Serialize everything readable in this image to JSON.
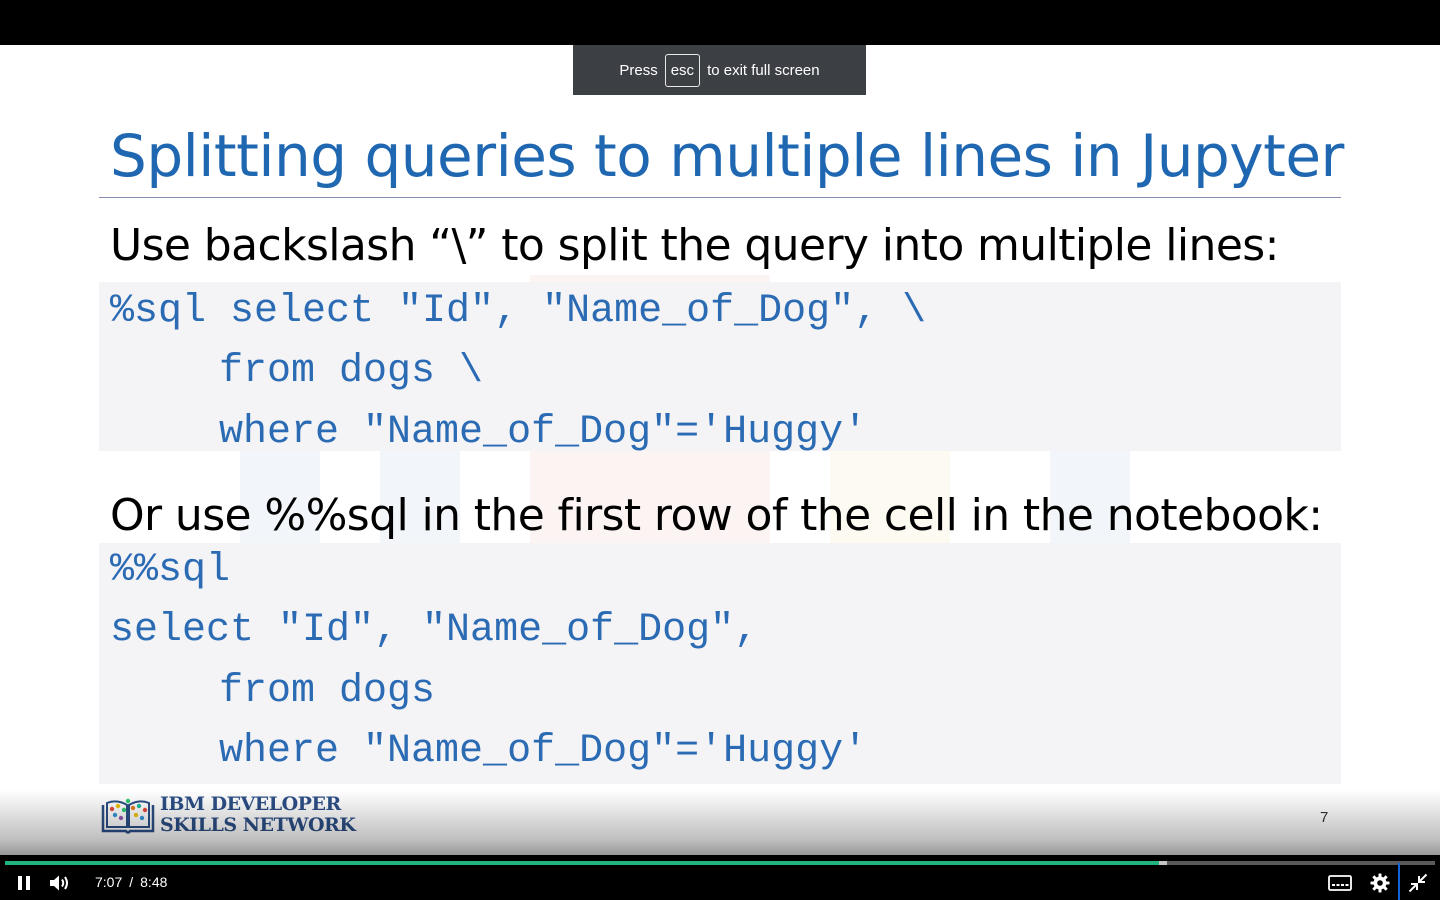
{
  "fullscreen_notice": {
    "prefix": "Press",
    "key": "esc",
    "suffix": "to exit full screen"
  },
  "slide": {
    "title": "Splitting queries to multiple lines in Jupyter",
    "instruction_1": "Use backslash “\\”  to split the query into multiple lines:",
    "code_1": [
      "%sql select \"Id\", \"Name_of_Dog\", \\",
      "    from dogs \\",
      "    where \"Name_of_Dog\"='Huggy'"
    ],
    "instruction_2": "Or use %%sql in the first row of the cell in the notebook:",
    "code_2": [
      "%%sql",
      "select \"Id\", \"Name_of_Dog\",",
      "    from dogs",
      "    where \"Name_of_Dog\"='Huggy'"
    ],
    "logo": {
      "line_1": "IBM DEVELOPER",
      "line_2": "SKILLS NETWORK"
    },
    "page_number": "7"
  },
  "player": {
    "current_time": "7:07",
    "separator": "/",
    "duration": "8:48",
    "progress_fraction": 0.8068,
    "buffered_fraction": 0.8126,
    "accent_color": "#22b47d",
    "icons": {
      "play_pause": "pause-icon",
      "volume": "volume-icon",
      "captions": "captions-icon",
      "settings": "gear-icon",
      "fullscreen": "exit-fullscreen-icon"
    }
  },
  "colors": {
    "title": "#1f67b1",
    "code": "#2a6bb4",
    "code_background": "#f4f3f6",
    "logo": "#2c4f86"
  }
}
